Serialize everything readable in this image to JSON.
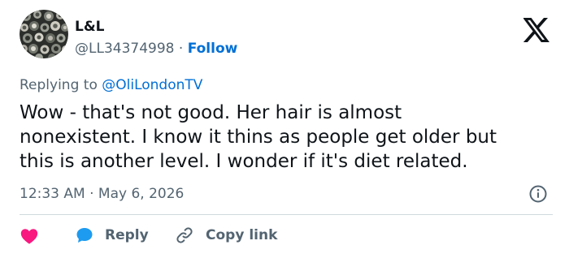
{
  "author": {
    "name": "L&L",
    "handle": "@LL34374998",
    "separator": "·",
    "follow_label": "Follow"
  },
  "reply_context": {
    "prefix": "Replying to",
    "target": "@OliLondonTV"
  },
  "tweet": {
    "text": "Wow - that's not good. Her hair is almost\nnonexistent. I know it thins as people get older but\nthis is another level. I wonder if it's diet related.",
    "timestamp": "12:33 AM · May 6, 2026"
  },
  "actions": {
    "reply_label": "Reply",
    "copy_link_label": "Copy link"
  },
  "icons": {
    "logo": "x-logo-icon",
    "info": "info-icon",
    "like": "heart-icon",
    "reply": "speech-bubble-icon",
    "copy": "link-icon"
  },
  "colors": {
    "text": "#0f1419",
    "secondary": "#536471",
    "link": "#006fd6",
    "heart": "#f91880",
    "reply_icon": "#1d9bf0",
    "divider": "#cfd9de"
  }
}
